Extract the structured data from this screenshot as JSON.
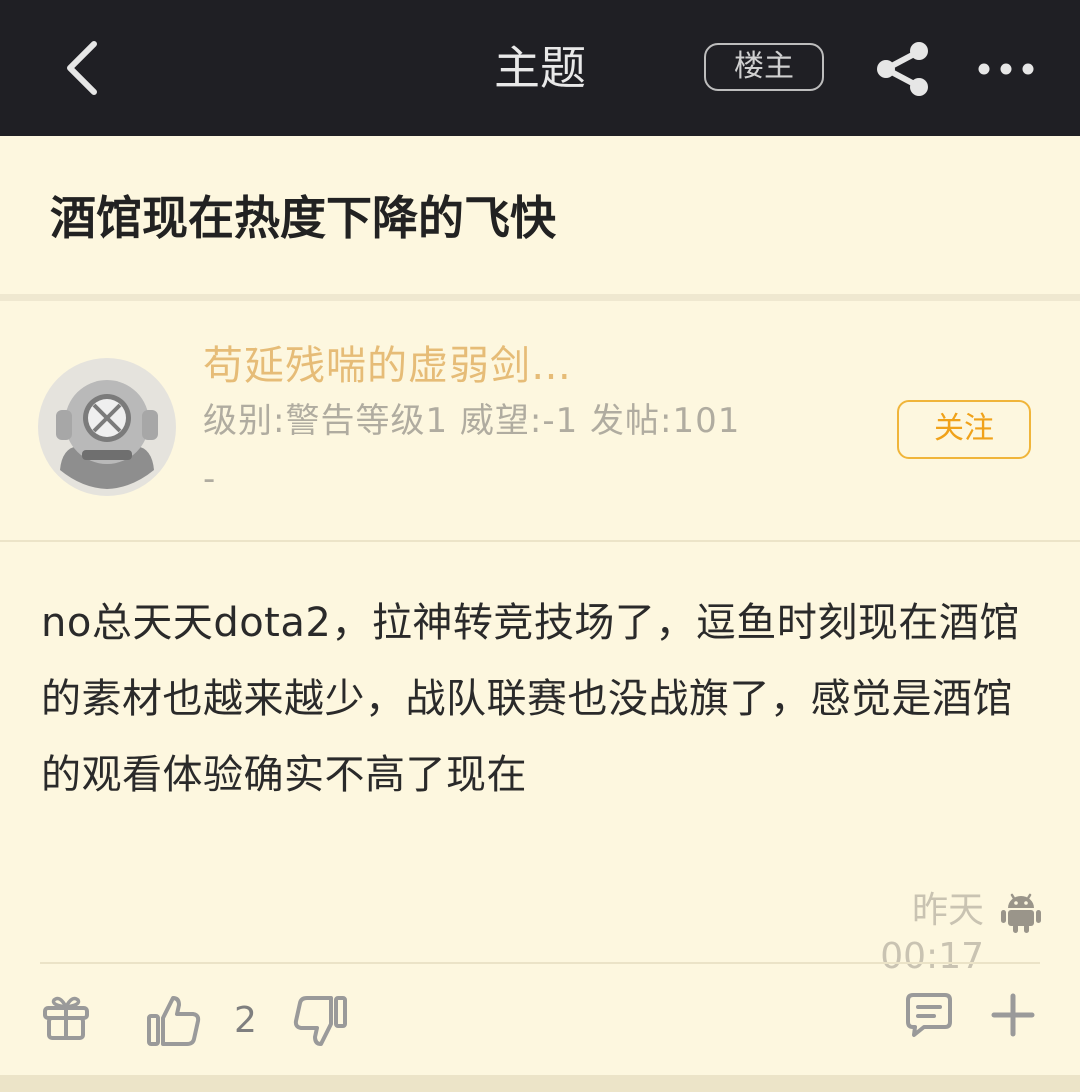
{
  "header": {
    "title": "主题",
    "owner_label": "楼主"
  },
  "post": {
    "title": "酒馆现在热度下降的飞快",
    "author": {
      "name": "苟延残喘的虚弱剑…",
      "meta": "级别:警告等级1 威望:-1 发帖:101",
      "meta_extra": "-",
      "follow_label": "关注"
    },
    "body": "no总天天dota2，拉神转竞技场了，逗鱼时刻现在酒馆的素材也越来越少，战队联赛也没战旗了，感觉是酒馆的观看体验确实不高了现在",
    "timestamp": "昨天 00:17",
    "like_count": "2"
  },
  "icons": {
    "back": "back-arrow-icon",
    "share": "share-icon",
    "more": "more-icon",
    "avatar": "diver-helmet-avatar",
    "device": "android-icon",
    "gift": "gift-icon",
    "like": "thumbs-up-icon",
    "dislike": "thumbs-down-icon",
    "comment": "comment-icon",
    "add": "plus-icon"
  },
  "colors": {
    "header_bg": "#1f1f24",
    "page_bg": "#fdf7df",
    "author_name": "#e6bc77",
    "follow_accent": "#f0b53a"
  }
}
